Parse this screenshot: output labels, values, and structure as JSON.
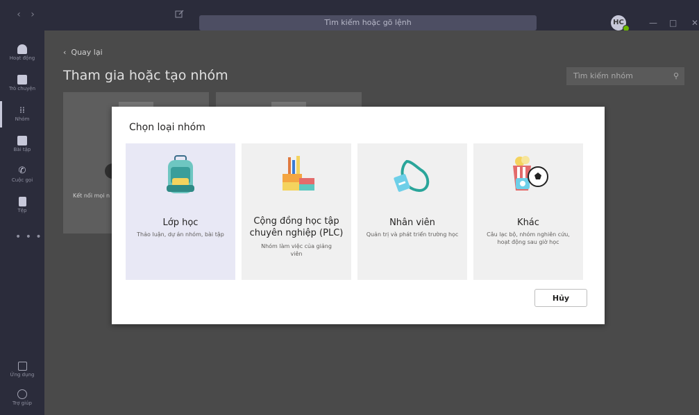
{
  "titlebar": {
    "search_placeholder": "Tìm kiếm hoặc gõ lệnh",
    "avatar_initials": "HC",
    "back_arrow": "‹",
    "forward_arrow": "›"
  },
  "rail": {
    "items": [
      {
        "label": "Hoạt động",
        "icon": "bell-icon"
      },
      {
        "label": "Trò chuyện",
        "icon": "chat-icon"
      },
      {
        "label": "Nhóm",
        "icon": "teams-icon"
      },
      {
        "label": "Bài tập",
        "icon": "assignments-icon"
      },
      {
        "label": "Cuộc gọi",
        "icon": "phone-icon"
      },
      {
        "label": "Tệp",
        "icon": "file-icon"
      }
    ],
    "more": "• • •",
    "apps_label": "Ứng dụng",
    "help_label": "Trợ giúp"
  },
  "main": {
    "back_label": "Quay lại",
    "title": "Tham gia hoặc tạo nhóm",
    "search_team_placeholder": "Tìm kiếm nhóm",
    "bg_card_text": "Kết nối mọi n"
  },
  "modal": {
    "title": "Chọn loại nhóm",
    "cards": [
      {
        "name": "Lớp học",
        "desc": "Thảo luận, dự án nhóm, bài tập",
        "icon": "backpack-icon"
      },
      {
        "name": "Cộng đồng học tập chuyên nghiệp (PLC)",
        "desc": "Nhóm làm việc của giảng viên",
        "icon": "books-icon"
      },
      {
        "name": "Nhân viên",
        "desc": "Quản trị và phát triển trường học",
        "icon": "lanyard-icon"
      },
      {
        "name": "Khác",
        "desc": "Câu lạc bộ, nhóm nghiên cứu, hoạt động sau giờ học",
        "icon": "popcorn-ball-icon"
      }
    ],
    "cancel_label": "Hủy"
  },
  "colors": {
    "rail_bg": "#2b2c3b",
    "overlay": "#4a4a4a",
    "selected_card": "#e8e8f5",
    "card": "#f0f0f0"
  }
}
